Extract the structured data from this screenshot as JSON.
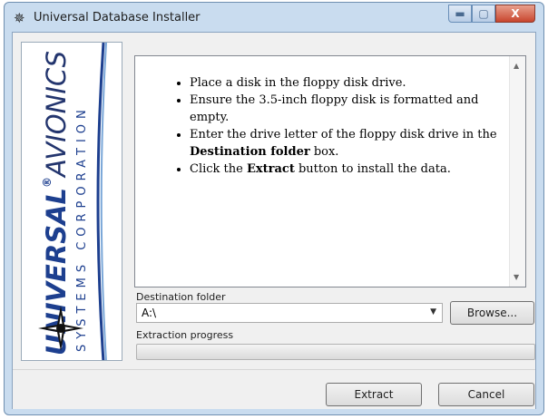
{
  "window": {
    "title": "Universal Database Installer",
    "controls": {
      "minimize": "▬",
      "maximize": "▢",
      "close": "X"
    }
  },
  "logo": {
    "brand_bold": "UNIVERSAL",
    "brand_mark": "®",
    "brand_light": "AVIONICS",
    "subline": "SYSTEMS CORPORATION"
  },
  "instructions": [
    {
      "text": "Place a disk in the floppy disk drive."
    },
    {
      "text": "Ensure the 3.5-inch floppy disk is formatted and empty."
    },
    {
      "pre": "Enter the drive letter of the floppy disk drive in the ",
      "bold": "Destination folder",
      "post": " box."
    },
    {
      "pre": "Click the ",
      "bold": "Extract",
      "post": " button to install the data."
    }
  ],
  "destination": {
    "label": "Destination folder",
    "value": "A:\\",
    "browse_label": "Browse..."
  },
  "progress": {
    "label": "Extraction progress",
    "value": 0
  },
  "footer": {
    "extract_label": "Extract",
    "cancel_label": "Cancel"
  },
  "colors": {
    "frame": "#c9dcef",
    "logo_blue": "#1d3f8f",
    "progress_fill": "#06b025"
  },
  "icons": {
    "app": "compass-star-icon",
    "combo": "chevron-down-icon",
    "scroll_up": "scroll-up-arrow-icon",
    "scroll_down": "scroll-down-arrow-icon"
  }
}
